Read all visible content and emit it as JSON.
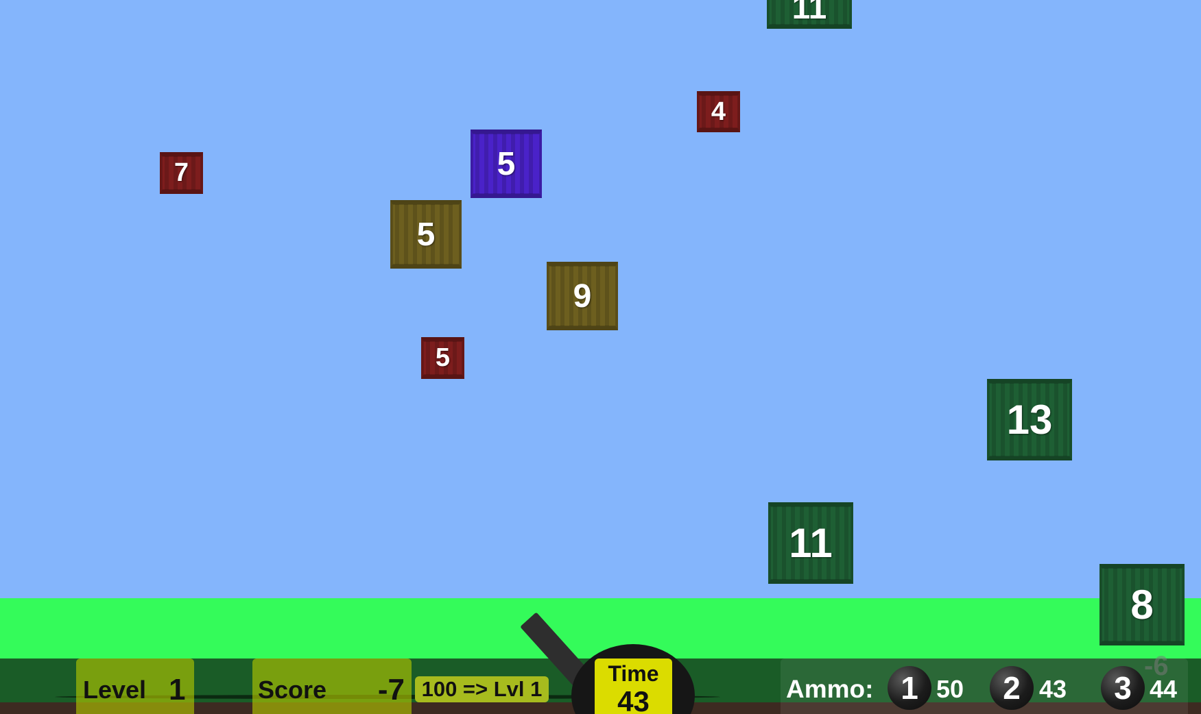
{
  "colors": {
    "sky": "#84b5fc",
    "grass": "#34fb5a",
    "hud_bar": "#1a5c27",
    "crate_green": "#1e5f34",
    "crate_red": "#7d1d1d",
    "crate_olive": "#6d5f1f",
    "crate_blue": "#4a22c9",
    "time_box": "#dbdc00"
  },
  "crates": [
    {
      "label": "11",
      "color": "green"
    },
    {
      "label": "4",
      "color": "red"
    },
    {
      "label": "7",
      "color": "red"
    },
    {
      "label": "5",
      "color": "blue"
    },
    {
      "label": "5",
      "color": "olive"
    },
    {
      "label": "9",
      "color": "olive"
    },
    {
      "label": "5",
      "color": "red"
    },
    {
      "label": "13",
      "color": "green"
    },
    {
      "label": "11",
      "color": "green"
    },
    {
      "label": "8",
      "color": "green"
    }
  ],
  "hud": {
    "level_label": "Level",
    "level_value": "1",
    "score_label": "Score",
    "score_value": "-7",
    "goal_text": "100 => Lvl 1",
    "time_label": "Time",
    "time_value": "43",
    "ammo_label": "Ammo:",
    "ammo": [
      {
        "key": "1",
        "count": "50"
      },
      {
        "key": "2",
        "count": "43"
      },
      {
        "key": "3",
        "count": "44"
      }
    ],
    "floating_score": "-6"
  },
  "icons": {
    "cannon": "cannon-icon",
    "ammo_ball": "cannonball-icon"
  }
}
